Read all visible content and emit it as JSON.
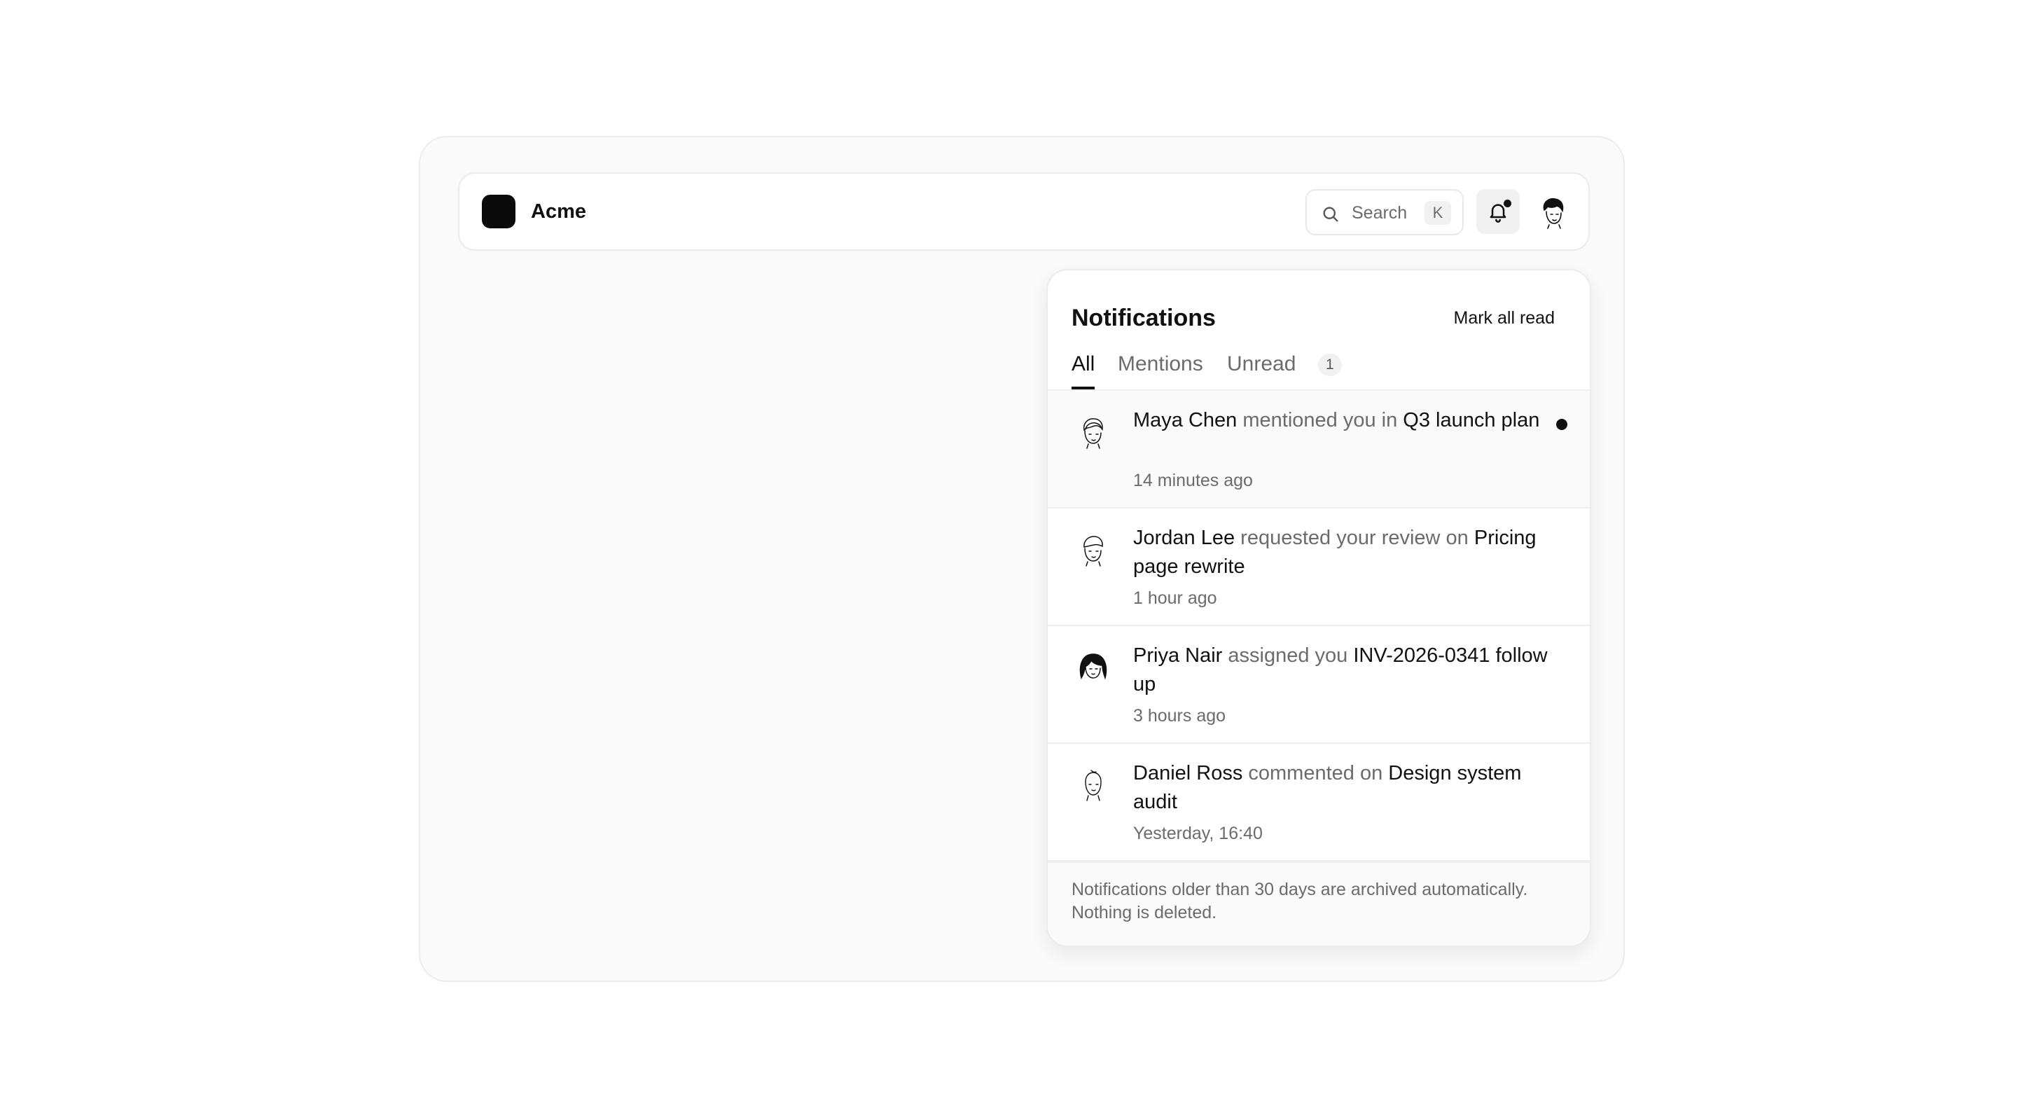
{
  "app": {
    "name": "Acme",
    "logo_icon": "logo-mark"
  },
  "header": {
    "search_label": "Search",
    "search_shortcut": "K",
    "notification_icon": "bell-icon",
    "has_unread_indicator": true,
    "user_avatar": "user-avatar"
  },
  "panel": {
    "title": "Notifications",
    "mark_all_read": "Mark all read",
    "tabs": [
      {
        "label": "All",
        "active": true
      },
      {
        "label": "Mentions",
        "active": false
      },
      {
        "label": "Unread",
        "active": false,
        "badge": "1"
      }
    ],
    "notifications": [
      {
        "actor": "Maya Chen",
        "action": " mentioned you in ",
        "target": "Q3 launch plan",
        "time": "14 minutes ago",
        "unread": true,
        "avatar": "maya-avatar"
      },
      {
        "actor": "Jordan Lee",
        "action": " requested your review on ",
        "target": "Pricing page rewrite",
        "time": "1 hour ago",
        "unread": false,
        "avatar": "jordan-avatar"
      },
      {
        "actor": "Priya Nair",
        "action": " assigned you ",
        "target": "INV-2026-0341 follow up",
        "time": "3 hours ago",
        "unread": false,
        "avatar": "priya-avatar"
      },
      {
        "actor": "Daniel Ross",
        "action": " commented on ",
        "target": "Design system audit",
        "time": "Yesterday, 16:40",
        "unread": false,
        "avatar": "daniel-avatar"
      }
    ],
    "footer": "Notifications older than 30 days are archived automatically. Nothing is deleted."
  },
  "colors": {
    "text_primary": "#111111",
    "text_muted": "#6b6b6b",
    "border": "#ececec",
    "unread_dot": "#111111",
    "logo": "#0a0a0a"
  }
}
